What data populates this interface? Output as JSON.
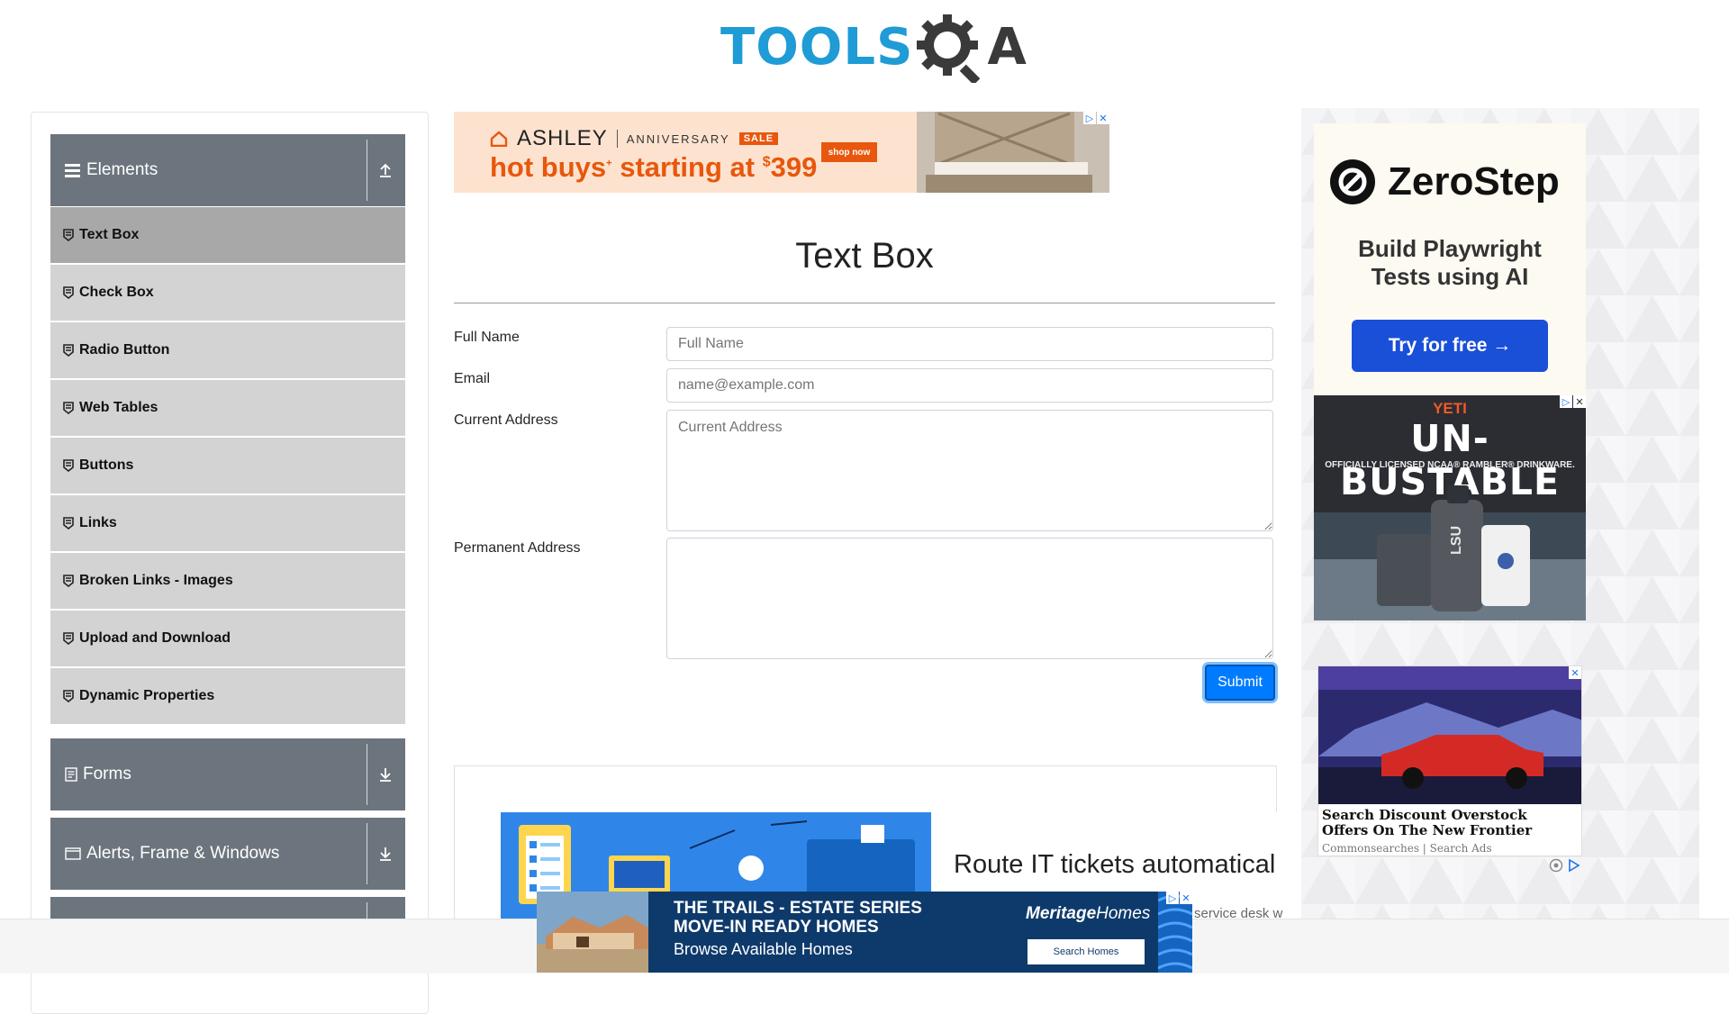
{
  "logo": {
    "text_tools": "TOOLS",
    "text_a": "A"
  },
  "sidebar": {
    "groups": [
      {
        "label": "Elements",
        "expanded": true
      },
      {
        "label": "Forms",
        "expanded": false
      },
      {
        "label": "Alerts, Frame & Windows",
        "expanded": false
      }
    ],
    "items": [
      {
        "label": "Text Box",
        "active": true
      },
      {
        "label": "Check Box"
      },
      {
        "label": "Radio Button"
      },
      {
        "label": "Web Tables"
      },
      {
        "label": "Buttons"
      },
      {
        "label": "Links"
      },
      {
        "label": "Broken Links - Images"
      },
      {
        "label": "Upload and Download"
      },
      {
        "label": "Dynamic Properties"
      }
    ]
  },
  "main": {
    "title": "Text Box",
    "form": {
      "full_name_label": "Full Name",
      "full_name_placeholder": "Full Name",
      "email_label": "Email",
      "email_placeholder": "name@example.com",
      "current_address_label": "Current Address",
      "current_address_placeholder": "Current Address",
      "permanent_address_label": "Permanent Address",
      "submit_label": "Submit"
    }
  },
  "ads": {
    "top": {
      "brand": "ASHLEY",
      "tag": "ANNIVERSARY",
      "sale": "SALE",
      "headline_a": "hot buys",
      "headline_b": "starting at",
      "price_symbol": "$",
      "price": "399",
      "cta": "shop now",
      "bg": "#fde3cf",
      "accent": "#e8570d"
    },
    "zerostep": {
      "brand": "ZeroStep",
      "line1": "Build Playwright",
      "line2": "Tests using AI",
      "cta": "Try for free →",
      "button_color": "#1a4fd8"
    },
    "yeti": {
      "brand": "YETI",
      "headline": "UN-BUSTABLE",
      "sub": "OFFICIALLY LICENSED NCAA® RAMBLER® DRINKWARE.",
      "cup_text": "LSU"
    },
    "truck": {
      "headline": "Search Discount Overstock Offers On The New Frontier Truck From...",
      "source": "Commonsearches | Search Ads"
    },
    "route": {
      "headline": "Route IT tickets automatical",
      "sub": "service desk w"
    },
    "bottom": {
      "line1": "THE TRAILS - ESTATE SERIES",
      "line2": "MOVE-IN READY HOMES",
      "line3": "Browse Available Homes",
      "brand": "Meritage",
      "brand_suffix": "Homes",
      "cta": "Search Homes",
      "bg": "#0e3a6b"
    }
  }
}
